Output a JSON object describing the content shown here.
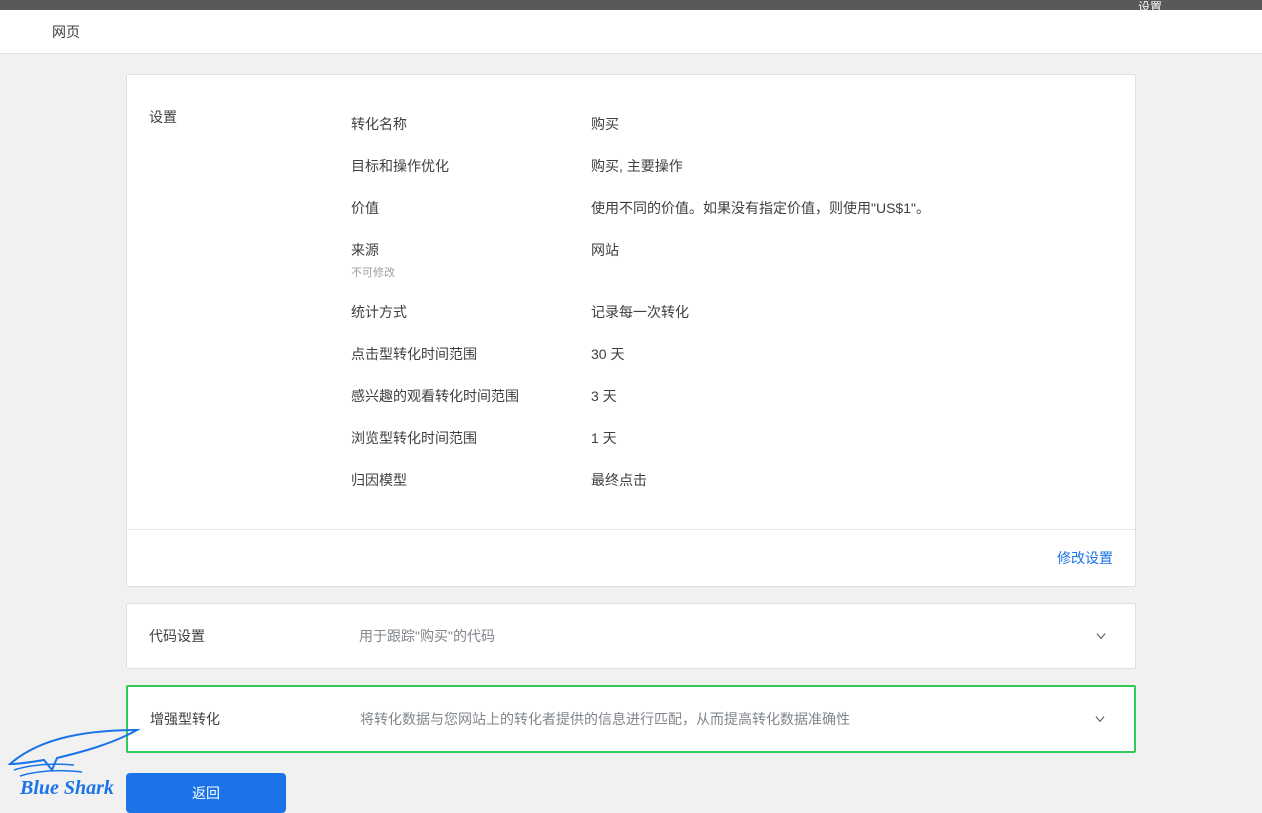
{
  "top": {
    "hidden_label": "设置"
  },
  "header": {
    "title": "网页"
  },
  "settings": {
    "section_title": "设置",
    "rows": [
      {
        "label": "转化名称",
        "value": "购买"
      },
      {
        "label": "目标和操作优化",
        "value": "购买, 主要操作"
      },
      {
        "label": "价值",
        "value": "使用不同的价值。如果没有指定价值，则使用\"US$1\"。"
      },
      {
        "label": "来源",
        "sublabel": "不可修改",
        "value": "网站"
      },
      {
        "label": "统计方式",
        "value": "记录每一次转化"
      },
      {
        "label": "点击型转化时间范围",
        "value": "30 天"
      },
      {
        "label": "感兴趣的观看转化时间范围",
        "value": "3 天"
      },
      {
        "label": "浏览型转化时间范围",
        "value": "1 天"
      },
      {
        "label": "归因模型",
        "value": "最终点击"
      }
    ],
    "edit_link": "修改设置"
  },
  "code_panel": {
    "title": "代码设置",
    "description": "用于跟踪\"购买\"的代码"
  },
  "enhanced_panel": {
    "title": "增强型转化",
    "description": "将转化数据与您网站上的转化者提供的信息进行匹配，从而提高转化数据准确性"
  },
  "buttons": {
    "back": "返回"
  },
  "brand": {
    "name": "Blue Shark"
  }
}
